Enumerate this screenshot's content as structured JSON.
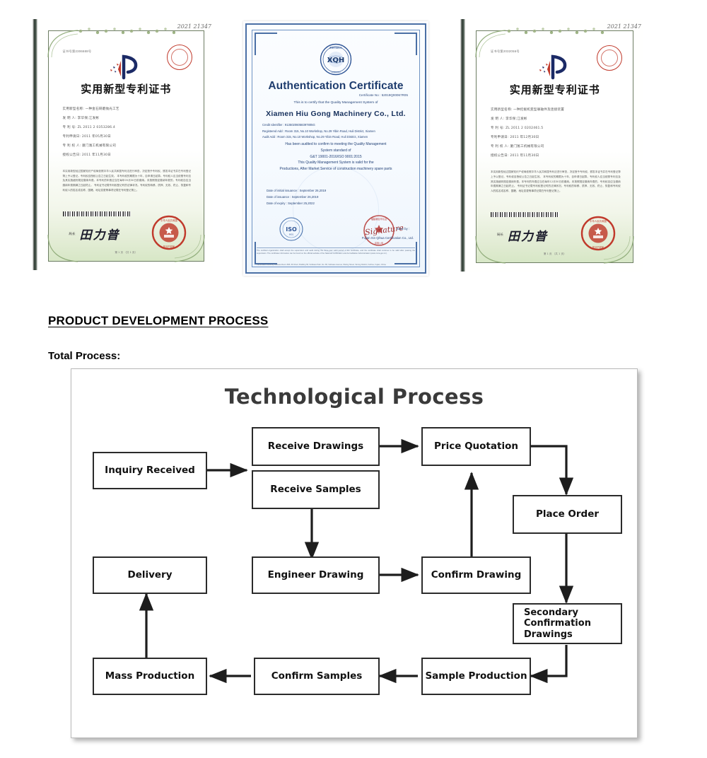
{
  "certificates": [
    {
      "kind": "cn-patent",
      "cert_no": "证书号第2306688号",
      "title": "实用新型专利证书",
      "fields": [
        "实用新型名称: 一种金石研磨抛光工艺",
        "发 明 人: 李华保;江发彬",
        "专 利 号: ZL 2011 2 0353286.4",
        "专利申请日: 2011 年05月30日",
        "专 利 权 人: 厦门潍工机械有限公司",
        "授权公告日: 2011 年11月30日"
      ],
      "body": "本实用新型经过国家知识产权局依照中华人民共和国专利法进行审查，决定授予专利权，颁发本证书并在专利登记簿上予以登记。专利权自授权公告之日起生效。 本专利权的期限为十年，自申请日起算。专利权人应当依照专利法及其实施细则规定缴纳年费。本专利的年费应当在每年05月30日前缴纳。未按照规定缴纳年费的，专利权自应当缴纳年费期满之日起终止。 专利证书记载专利权登记时的法律状况。专利权的转移、质押、无效、终止、恢复和专利权人的姓名或名称、国籍、地址变更等事项记载在专利登记簿上。",
      "signature_label": "局长",
      "signature": "田力普",
      "footer": "第 1 页 （共 1 页）",
      "handwriting": "2021\n21347"
    },
    {
      "kind": "iso",
      "title": "Authentication Certificate",
      "cert_no_label": "Certificate No : 52019Q00067R05",
      "subtitle": "This is to certify that the Quality Management System of",
      "company": "Xiamen  Hiu Gong  Machinery Co., Ltd.",
      "address_lines": [
        "Credit Identifier : 91350206058397805G",
        "Registered Add : Room 315, No.10 Workshop, No.29 Yibin Road, Huli District, Xiamen",
        "Audit        Add : Room 315, No.10 Workshop, No.29 Yibin Road, Huli District, Xiamen"
      ],
      "statement_lines": [
        "Has been audited to confirm to meeting the Quality Management",
        "System standard of",
        "G&T 19001-2016/ISO 9001:2015",
        "This Quality Management System is valid for the",
        "Productions, After Market Service of construction machinery spare parts"
      ],
      "dates": [
        "Date of initial issuance : September 26,2019",
        "Date of issuance : September 26,2019",
        "Date of expiry : September 25,2022"
      ],
      "issue_by_label": "Issue by :",
      "issuer": "Fujian Xin Qihua Certification Co., Ltd.",
      "iso_logo_text": "ISO",
      "logo_text": "XQH",
      "fine_print": "The certified organization shall accept the supervision and audit during the three-year valid period of the certificate, and the certificate shall continue to be valid after passing the supervision. The certificate information can be found on the official website of the National Certification and Accreditation Administration (www.cnca.gov.cn).",
      "fine_print2": "Certification Authority Address:Room 806, 6th Floor, Building 56, Software Park, No. 86, Software Avenue, Wuling Street, Siming District, Fuzhou, Fujian, China"
    },
    {
      "kind": "cn-patent",
      "cert_no": "证书号第2032056号",
      "title": "实用新型专利证书",
      "fields": [
        "实用新型名称: 一种挖掘机变型联轴件及连接装置",
        "发 明 人: 李华保;江发彬",
        "专 利 号: ZL 2011 2 0202461.5",
        "专利申请日: 2011 年12月30日",
        "专 利 权 人: 厦门潍工机械有限公司",
        "授权公告日: 2011 年11月30日"
      ],
      "body": "本实用新型经过国家知识产权局依照中华人民共和国专利法进行审查，决定授予专利权，颁发本证书并在专利登记簿上予以登记。专利权自授权公告之日起生效。 本专利权的期限为十年，自申请日起算。专利权人应当依照专利法及其实施细则规定缴纳年费。本专利的年费应当在每年12月30日前缴纳。未按照规定缴纳年费的，专利权自应当缴纳年费期满之日起终止。 专利证书记载专利权登记时的法律状况。专利权的转移、质押、无效、终止、恢复和专利权人的姓名或名称、国籍、地址变更等事项记载在专利登记簿上。",
      "signature_label": "局长",
      "signature": "田力普",
      "footer": "第 1 页 （共 1 页）",
      "handwriting": "2021\n21347"
    }
  ],
  "section": {
    "title": "PRODUCT DEVELOPMENT PROCESS",
    "subtitle": "Total Process:"
  },
  "flowchart": {
    "title": "Technological Process",
    "nodes": [
      {
        "id": "inquiry",
        "label": "Inquiry Received"
      },
      {
        "id": "recv_draw",
        "label": "Receive Drawings"
      },
      {
        "id": "recv_samp",
        "label": "Receive  Samples"
      },
      {
        "id": "price",
        "label": "Price Quotation"
      },
      {
        "id": "place",
        "label": "Place Order"
      },
      {
        "id": "delivery",
        "label": "Delivery"
      },
      {
        "id": "eng_draw",
        "label": "Engineer Drawing"
      },
      {
        "id": "conf_draw",
        "label": "Confirm Drawing"
      },
      {
        "id": "secondary",
        "label": "Secondary\nConfirmation\nDrawings"
      },
      {
        "id": "mass",
        "label": "Mass Production"
      },
      {
        "id": "conf_samp",
        "label": "Confirm Samples"
      },
      {
        "id": "samp_prod",
        "label": "Sample Production"
      }
    ],
    "edges": [
      "inquiry -> receive drawings / receive samples",
      "receive drawings -> price quotation",
      "price quotation -> place order",
      "place order -> secondary confirmation drawings",
      "secondary confirmation drawings -> sample production",
      "receive samples -> engineer drawing",
      "engineer drawing -> confirm drawing",
      "confirm drawing -> price quotation",
      "sample production -> confirm samples",
      "confirm samples -> mass production",
      "mass production -> delivery"
    ]
  }
}
